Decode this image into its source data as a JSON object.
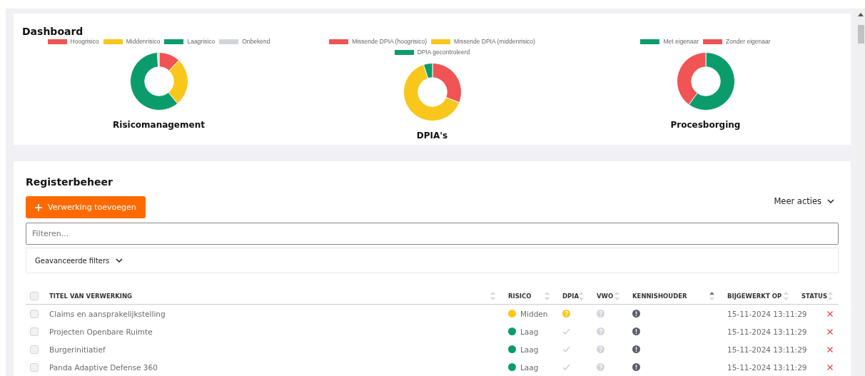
{
  "dashboard": {
    "title": "Dashboard",
    "charts": [
      {
        "title": "Risicomanagement",
        "legend": [
          {
            "label": "Hoogrisico",
            "color": "#f05454"
          },
          {
            "label": "Middenrisico",
            "color": "#f9c71b"
          },
          {
            "label": "Laagrisico",
            "color": "#0c9c6c"
          },
          {
            "label": "Onbekend",
            "color": "#d1d5db"
          }
        ]
      },
      {
        "title": "DPIA's",
        "legend": [
          {
            "label": "Missende DPIA (hoogrisico)",
            "color": "#f05454"
          },
          {
            "label": "Missende DPIA (middenrisico)",
            "color": "#f9c71b"
          },
          {
            "label": "DPIA gecontroleerd",
            "color": "#0c9c6c"
          }
        ]
      },
      {
        "title": "Procesborging",
        "legend": [
          {
            "label": "Met eigenaar",
            "color": "#0c9c6c"
          },
          {
            "label": "Zonder eigenaar",
            "color": "#f05454"
          }
        ]
      }
    ]
  },
  "register": {
    "title": "Registerbeheer",
    "add_button": {
      "label": "Verwerking toevoegen"
    },
    "more_actions": {
      "label": "Meer acties"
    },
    "filter": {
      "placeholder": "Filteren..."
    },
    "advanced_filters": {
      "label": "Geavanceerde filters",
      "expanded": false
    },
    "table": {
      "select_all": {
        "checked": false
      },
      "columns": [
        {
          "label": "TITEL VAN VERWERKING",
          "sorted": false
        },
        {
          "label": "RISICO",
          "sorted": false
        },
        {
          "label": "DPIA",
          "sorted": false
        },
        {
          "label": "VWO",
          "sorted": false
        },
        {
          "label": "KENNISHOUDER",
          "sorted": true
        },
        {
          "label": "BIJGEWERKT OP",
          "sorted": false
        },
        {
          "label": "STATUS",
          "sorted": false
        }
      ],
      "rows": [
        {
          "checked": false,
          "title": "Claims en aansprakelijkstelling",
          "risk": {
            "label": "Midden",
            "color": "#f9c71b"
          },
          "dpia": {
            "kind": "question"
          },
          "vwo": {
            "kind": "unknown"
          },
          "kennishouder": {
            "kind": "missing"
          },
          "updated": "15-11-2024 13:11:29",
          "status": {
            "kind": "rejected"
          }
        },
        {
          "checked": false,
          "title": "Projecten Openbare Ruimte",
          "risk": {
            "label": "Laag",
            "color": "#0c9c6c"
          },
          "dpia": {
            "kind": "done"
          },
          "vwo": {
            "kind": "unknown"
          },
          "kennishouder": {
            "kind": "missing"
          },
          "updated": "15-11-2024 13:11:29",
          "status": {
            "kind": "rejected"
          }
        },
        {
          "checked": false,
          "title": "Burgerinitiatief",
          "risk": {
            "label": "Laag",
            "color": "#0c9c6c"
          },
          "dpia": {
            "kind": "done"
          },
          "vwo": {
            "kind": "unknown"
          },
          "kennishouder": {
            "kind": "missing"
          },
          "updated": "15-11-2024 13:11:29",
          "status": {
            "kind": "rejected"
          }
        },
        {
          "checked": false,
          "title": "Panda Adaptive Defense 360",
          "risk": {
            "label": "Laag",
            "color": "#0c9c6c"
          },
          "dpia": {
            "kind": "done"
          },
          "vwo": {
            "kind": "unknown"
          },
          "kennishouder": {
            "kind": "missing"
          },
          "updated": "15-11-2024 13:11:29",
          "status": {
            "kind": "rejected"
          }
        }
      ]
    }
  }
}
